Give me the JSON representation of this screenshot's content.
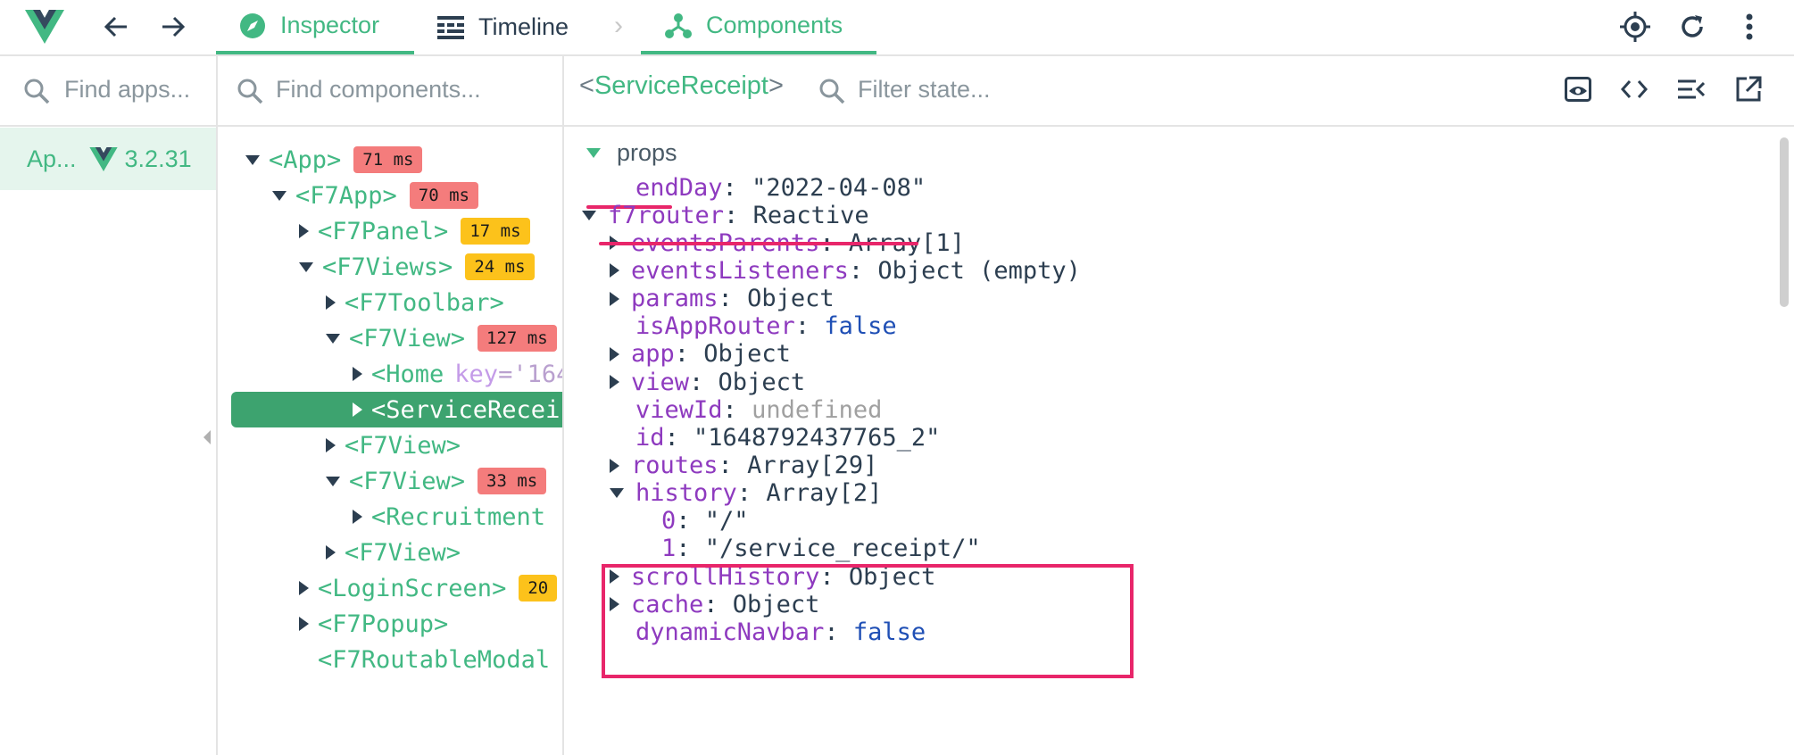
{
  "topbar": {
    "tabs": [
      {
        "label": "Inspector",
        "active": true,
        "icon": "compass-icon"
      },
      {
        "label": "Timeline",
        "active": false,
        "icon": "timeline-icon"
      },
      {
        "label": "Components",
        "active": true,
        "icon": "components-tree-icon"
      }
    ],
    "separator": "›",
    "right_icons": [
      "target-icon",
      "refresh-icon",
      "more-vertical-icon"
    ],
    "nav_icons": [
      "vue-logo",
      "arrow-left-icon",
      "arrow-right-icon"
    ]
  },
  "apps": {
    "search_placeholder": "Find apps...",
    "items": [
      {
        "name": "Ap...",
        "version": "3.2.31"
      }
    ]
  },
  "components": {
    "search_placeholder": "Find components...",
    "tree": [
      {
        "label": "<App>",
        "toggle": "open",
        "badge": "71 ms",
        "badge_color": "red"
      },
      {
        "label": "<F7App>",
        "toggle": "open",
        "badge": "70 ms",
        "badge_color": "red"
      },
      {
        "label": "<F7Panel>",
        "toggle": "closed",
        "badge": "17 ms",
        "badge_color": "amber"
      },
      {
        "label": "<F7Views>",
        "toggle": "open",
        "badge": "24 ms",
        "badge_color": "amber"
      },
      {
        "label": "<F7Toolbar>",
        "toggle": "closed"
      },
      {
        "label": "<F7View>",
        "toggle": "open",
        "badge": "127 ms",
        "badge_color": "red"
      },
      {
        "label": "<Home",
        "toggle": "closed",
        "key_attr": "key",
        "key_value": "='164"
      },
      {
        "label": "<ServiceRecei",
        "toggle": "closed",
        "selected": true
      },
      {
        "label": "<F7View>",
        "toggle": "closed"
      },
      {
        "label": "<F7View>",
        "toggle": "open",
        "badge": "33 ms",
        "badge_color": "red"
      },
      {
        "label": "<Recruitment",
        "toggle": "closed"
      },
      {
        "label": "<F7View>",
        "toggle": "closed"
      },
      {
        "label": "<LoginScreen>",
        "toggle": "closed",
        "badge": "20",
        "badge_color": "amber"
      },
      {
        "label": "<F7Popup>",
        "toggle": "closed"
      },
      {
        "label": "<F7RoutableModal",
        "toggle": "none"
      }
    ]
  },
  "inspector": {
    "component_name": "ServiceReceipt",
    "bracket_open": "<",
    "bracket_close": ">",
    "filter_placeholder": "Filter state...",
    "toolbar_icons": [
      "eye-icon",
      "code-icon",
      "collapse-list-icon",
      "open-external-icon"
    ],
    "section": "props",
    "state": [
      {
        "key": "endDay",
        "sep": ": ",
        "value": "\"2022-04-08\"",
        "kind": "str",
        "toggle": "none"
      },
      {
        "key": "f7router",
        "sep": ": ",
        "value": "Reactive",
        "kind": "str",
        "toggle": "open"
      },
      {
        "key": "eventsParents",
        "sep": ": ",
        "value": "Array[1]",
        "kind": "str",
        "toggle": "closed"
      },
      {
        "key": "eventsListeners",
        "sep": ": ",
        "value": "Object (empty)",
        "kind": "str",
        "toggle": "closed"
      },
      {
        "key": "params",
        "sep": ": ",
        "value": "Object",
        "kind": "str",
        "toggle": "closed"
      },
      {
        "key": "isAppRouter",
        "sep": ": ",
        "value": "false",
        "kind": "bool",
        "toggle": "none"
      },
      {
        "key": "app",
        "sep": ": ",
        "value": "Object",
        "kind": "str",
        "toggle": "closed"
      },
      {
        "key": "view",
        "sep": ": ",
        "value": "Object",
        "kind": "str",
        "toggle": "closed"
      },
      {
        "key": "viewId",
        "sep": ": ",
        "value": "undefined",
        "kind": "undef",
        "toggle": "none"
      },
      {
        "key": "id",
        "sep": ": ",
        "value": "\"1648792437765_2\"",
        "kind": "str",
        "toggle": "none"
      },
      {
        "key": "routes",
        "sep": ": ",
        "value": "Array[29]",
        "kind": "str",
        "toggle": "closed"
      },
      {
        "key": "history",
        "sep": ": ",
        "value": "Array[2]",
        "kind": "str",
        "toggle": "open"
      },
      {
        "key": "0",
        "sep": ": ",
        "value": "\"/\"",
        "kind": "str",
        "toggle": "none"
      },
      {
        "key": "1",
        "sep": ": ",
        "value": "\"/service_receipt/\"",
        "kind": "str",
        "toggle": "none"
      },
      {
        "key": "scrollHistory",
        "sep": ": ",
        "value": "Object",
        "kind": "str",
        "toggle": "closed"
      },
      {
        "key": "cache",
        "sep": ": ",
        "value": "Object",
        "kind": "str",
        "toggle": "closed"
      },
      {
        "key": "dynamicNavbar",
        "sep": ": ",
        "value": "false",
        "kind": "bool",
        "toggle": "none"
      }
    ]
  },
  "colors": {
    "accent": "#42b883",
    "highlight": "#e8266a",
    "key": "#8e3abf",
    "badge_red": "#f47c7c",
    "badge_amber": "#fcc21b"
  }
}
